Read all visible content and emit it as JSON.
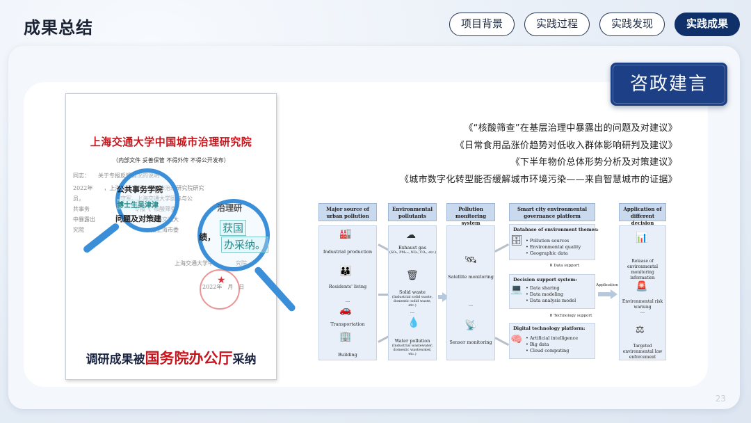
{
  "header": {
    "title": "成果总结",
    "nav": [
      {
        "label": "项目背景",
        "active": false
      },
      {
        "label": "实践过程",
        "active": false
      },
      {
        "label": "实践发现",
        "active": false
      },
      {
        "label": "实践成果",
        "active": true
      }
    ]
  },
  "ribbon": {
    "label": "咨政建言"
  },
  "advice_titles": [
    "《“核酸筛查”在基层治理中暴露出的问题及对建议》",
    "《日常食用品涨价趋势对低收入群体影响研判及建议》",
    "《下半年物价总体形势分析及对策建议》",
    "《城市数字化转型能否缓解城市环境污染——来自智慧城市的证据》"
  ],
  "document": {
    "header": "上海交通大学中国城市治理研究院",
    "sub": "（内部文件 妥善保管 不得外传 不得公开发布）",
    "greeting_line": "同志：　　关于专报反馈情况的说明",
    "lines": [
      "2022年　　，上海交通大学中国城市治理研究院研究",
      "员，　　　　　　　守军、上海交通大学国际与公",
      "共事务　　　　　　　　专报《“核酸筛查”",
      "中暴露出　　　　　　　　　　上海交通大",
      "究院　　　　　　　　　　　　报上海市委",
      "",
      "　　上海交通大学中　　　　究院"
    ],
    "mag_words": {
      "dept": "公共事务学院",
      "name": "博士生吴津津",
      "topic": "问题及对策建",
      "govern": "治理研",
      "accept1": "获国",
      "accept2": "办采纳。",
      "ji": "绩，"
    },
    "date": "2022年　月　日",
    "caption_prefix": "调研成果被",
    "caption_highlight": "国务院办公厅",
    "caption_suffix": "采纳"
  },
  "diagram": {
    "columns": [
      {
        "title": "Major source of urban pollution"
      },
      {
        "title": "Environmental pollutants"
      },
      {
        "title": "Pollution monitoring system"
      },
      {
        "title": "Smart city environmental governance platform"
      },
      {
        "title": "Application of different decision scenarios"
      }
    ],
    "sources": [
      "Industrial production",
      "Residents' living",
      "...",
      "Transportation",
      "Building"
    ],
    "pollutants": [
      {
        "name": "Exhaust gas",
        "detail": "(SO₂, PM₂.₅, NO₂, CO₂, etc.)"
      },
      {
        "name": "Solid waste",
        "detail": "(Industrial solid waste, domestic solid waste, etc.)"
      },
      {
        "name": "...",
        "detail": ""
      },
      {
        "name": "Water pollution",
        "detail": "(Industrial wastewater, domestic wastewater, etc.)"
      }
    ],
    "monitoring": [
      "Satellite monitoring",
      "...",
      "Sensor monitoring"
    ],
    "platform": {
      "db_title": "Database of environment themes:",
      "db_items": [
        "Pollution sources",
        "Environmental quality",
        "Geographic data"
      ],
      "data_support": "Data support",
      "dss_title": "Decision support system:",
      "dss_items": [
        "Data sharing",
        "Data modeling",
        "Data analysis model"
      ],
      "tech_support": "Technology support",
      "dtp_title": "Digital technology platform:",
      "dtp_items": [
        "Artificial intelligence",
        "Big data",
        "Cloud computing"
      ]
    },
    "application_label": "Application",
    "scenarios": [
      "Release of environmental monitoring information",
      "Environmental risk warning",
      "...",
      "Targeted environmental law enforcement"
    ]
  },
  "page_number": "23"
}
